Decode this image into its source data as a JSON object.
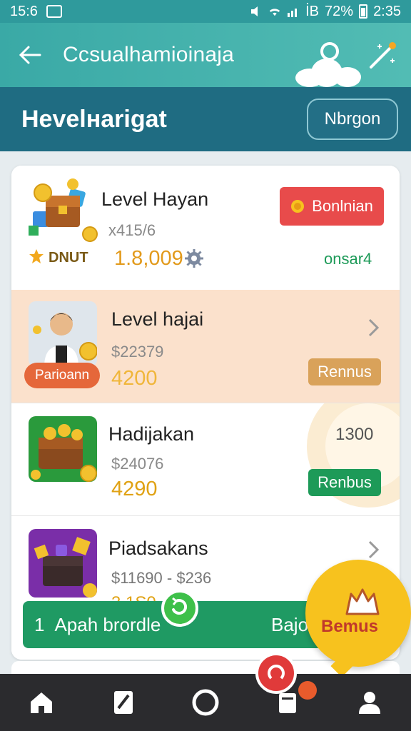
{
  "status_bar": {
    "time_left": "15:6",
    "battery": "72%",
    "signal_text": "İB",
    "time_right": "2:35"
  },
  "app_bar": {
    "title": "Ccsualhamioinaja"
  },
  "sub_header": {
    "title": "Hevelнarigat",
    "button_label": "Nbrgon"
  },
  "rows": [
    {
      "name": "Level Hayan",
      "sub": "х415/6",
      "amount": "1.8,009",
      "badge": "DNUT",
      "chip_label": "Bonlnian",
      "chip_color": "#e84b4b",
      "right_text": "onsar4"
    },
    {
      "name": "Level hajai",
      "sub": "$22379",
      "amount": "4200",
      "badge": "Parioann",
      "chip_label": "Rennus",
      "chip_color": "#d9a25a"
    },
    {
      "name": "Hadijakan",
      "sub": "$24076",
      "amount": "4290",
      "right_value": "1300",
      "chip_label": "Renbus",
      "chip_color": "#1d9a58"
    },
    {
      "name": "Piadsakans",
      "sub": "$11690 - $236",
      "amount": "3 1S0"
    }
  ],
  "action_bar": {
    "count": "1",
    "label": "Apah brordle",
    "right_label": "Bajo"
  },
  "bonus_fab": {
    "label": "Bemus"
  },
  "bottom_nav": [
    "home-icon",
    "edit-icon",
    "record-icon",
    "card-icon",
    "profile-icon"
  ]
}
